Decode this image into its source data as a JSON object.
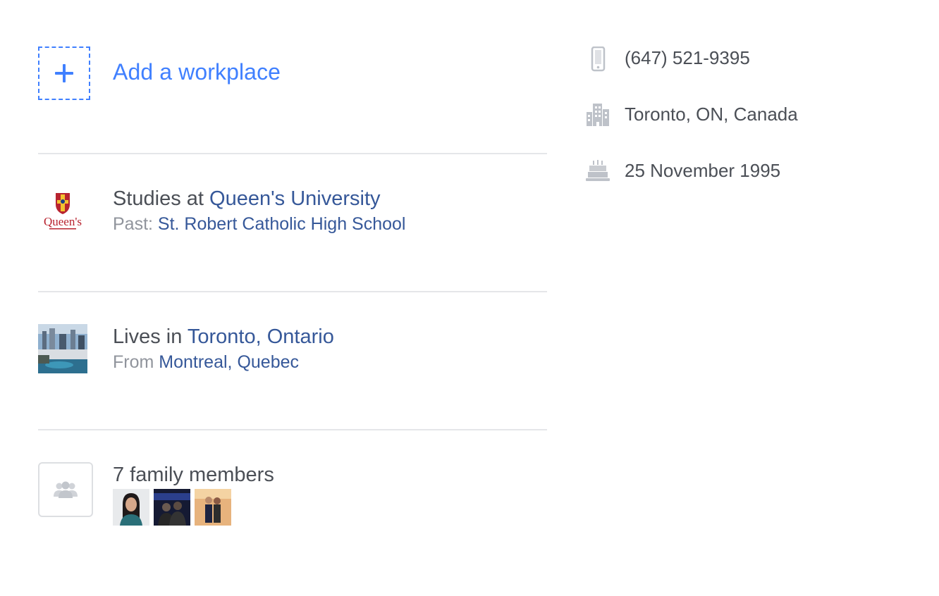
{
  "workplace": {
    "add_label": "Add a workplace"
  },
  "education": {
    "prefix": "Studies at ",
    "school": "Queen's University",
    "past_label": "Past: ",
    "past_school": "St. Robert Catholic High School",
    "logo_text": "Queen's"
  },
  "places": {
    "prefix": "Lives in ",
    "current_city": "Toronto, Ontario",
    "from_label": "From ",
    "hometown": "Montreal, Quebec"
  },
  "family": {
    "label": "7 family members"
  },
  "contact": {
    "phone": "(647) 521-9395",
    "location": "Toronto, ON, Canada",
    "birthday": "25 November 1995"
  },
  "icons": {
    "add": "plus-icon",
    "phone": "mobile-phone-icon",
    "location": "city-buildings-icon",
    "birthday": "birthday-cake-icon",
    "family": "people-group-icon"
  },
  "colors": {
    "accent_blue": "#4080ff",
    "link_blue": "#365899",
    "text": "#4b4f56",
    "muted": "#90949c",
    "icon_gray": "#bec2c9",
    "divider": "#e5e6e9"
  }
}
